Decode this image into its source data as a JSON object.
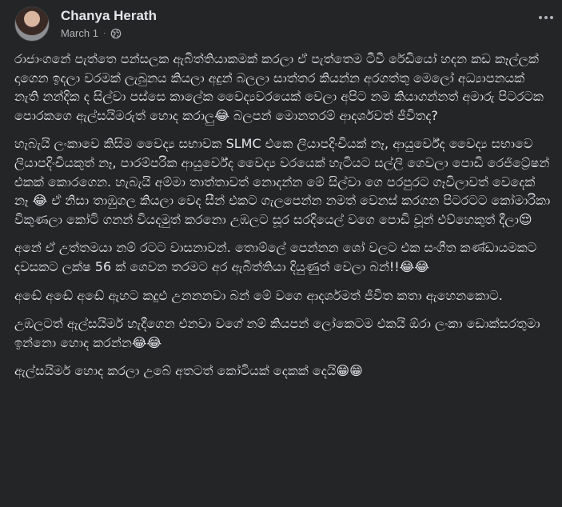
{
  "post": {
    "author": "Chanya Herath",
    "date": "March 1",
    "privacy_icon": "globe-icon",
    "more_icon": "more-options-icon",
    "paragraphs": [
      "රාජාංගනේ පැත්තෙ පන්සලක ඇබිත්තියාකමක් කරලා ඒ පැත්තෙම ටීවී රේඩියෝ හදන කඩ කෑල්ලක් දාගෙන ඉදලා වරමක් ලැබුනය කියලා අදුන් බලලා සාත්තර කියන්න අරගත්තු මෙලෝ අධ්‍යාපනයක් නැති නන්දික ද සිල්වා පස්සෙ කාලේක වෛද්‍යවරයෙක් වෙලා අපිට නම කියාගන්නත් අමාරු පිටරටක පොරකගෙ ඇල්සයිමරුත් හොද කරාලු😂 බලපන් මොනතරම් ආදර්ශවත් ජීවිතද?",
      "හැබැයි ලංකාවෙ කිසිම වෛද්‍ය සභාවක SLMC එකෙ ලියාපදිංචියක් නෑ, ආයුර්වේද වෛද්‍ය සභාවෙ ලියාපදිංචියකුත් නෑ, පාරම්පරික ආයුර්වේද වෛද්‍ය වරයෙක් හැටියට සල්ලි ගෙවලා පොඩි රෙජිට්‍රේෂන් එකක් කොරගෙන. හැබැයි අම්මා තාත්තාවත් නොදන්න මේ සිල්වා ගෙ පරපුරට ගෑවිලාවත් වෙදෙක් නෑ 😂 ඒ නිසා තාඹුගල කියලා වෙද සීන් එකට ගැලපෙන්න නමත් වෙනස් කරගන පිටරටට කෝමාරිකා විකුණලා කෝටි ගනන් වියදමුත් කරනො උඹලට සූර සරදියෙල් වගෙ පොඩි චූන් එව්හෙකුත් දීලා😌",
      "අනේ ඒ උත්තමයා නම් රටට වාසනාවන්. තොම්ලේ පෙන්නන ශෝ වලට එක සංගීත කණ්ඩායමකට දවසකට ලක්ෂ 56 ක් ගෙවන තරමට අර ඇබිත්තියා දියුණුත් වෙලා බන්!!😂😂",
      "අඬේ අඬේ අඬේ ඇහට කදුළු උනනනවා බන් මේ වගෙ ආදර්ශමත් ජීවිත කතා ඇහෙනකොට.",
      "උඹලටත් ඇල්සයිමර් හැදීගෙන එනවා වගේ නම් කියපන් ලෝකෙටම එකයි ඕරා ලංකා ඩොක්සරතුමා ඉන්නො හොද කරන්න😂😂",
      "ඇල්සයිමර් හොද කරලා උබේ අතටත් කෝටියක් දෙකක් දෙයි😁😁"
    ]
  }
}
